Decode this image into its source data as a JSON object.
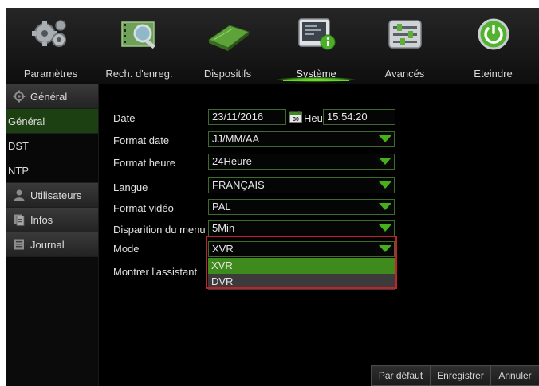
{
  "nav": {
    "items": [
      {
        "label": "Paramètres",
        "icon": "gears-icon"
      },
      {
        "label": "Rech. d'enreg.",
        "icon": "film-search-icon"
      },
      {
        "label": "Dispositifs",
        "icon": "dvr-device-icon"
      },
      {
        "label": "Système",
        "icon": "system-info-icon"
      },
      {
        "label": "Avancés",
        "icon": "sliders-icon"
      },
      {
        "label": "Eteindre",
        "icon": "power-icon"
      }
    ],
    "active_index": 3
  },
  "sidebar": {
    "items": [
      {
        "label": "Général",
        "kind": "group",
        "icon": "gear-icon"
      },
      {
        "label": "Général",
        "kind": "sub",
        "selected": true
      },
      {
        "label": "DST",
        "kind": "sub"
      },
      {
        "label": "NTP",
        "kind": "sub"
      },
      {
        "label": "Utilisateurs",
        "kind": "group",
        "icon": "user-icon"
      },
      {
        "label": "Infos",
        "kind": "group",
        "icon": "info-icon"
      },
      {
        "label": "Journal",
        "kind": "group",
        "icon": "log-icon"
      }
    ]
  },
  "form": {
    "date_label": "Date",
    "date_value": "23/11/2016",
    "calendar_day": "30",
    "time_label": "Heure",
    "time_value": "15:54:20",
    "date_format_label": "Format date",
    "date_format_value": "JJ/MM/AA",
    "time_format_label": "Format heure",
    "time_format_value": "24Heure",
    "language_label": "Langue",
    "language_value": "FRANÇAIS",
    "video_format_label": "Format vidéo",
    "video_format_value": "PAL",
    "menu_timeout_label": "Disparition du menu",
    "menu_timeout_value": "5Min",
    "mode_label": "Mode",
    "mode_value": "XVR",
    "mode_options": [
      "XVR",
      "DVR"
    ],
    "wizard_label": "Montrer l'assistant"
  },
  "buttons": {
    "default_label": "Par défaut",
    "save_label": "Enregistrer",
    "cancel_label": "Annuler"
  },
  "colors": {
    "accent_green": "#3f8a1d",
    "highlight_red": "#c0232b"
  }
}
